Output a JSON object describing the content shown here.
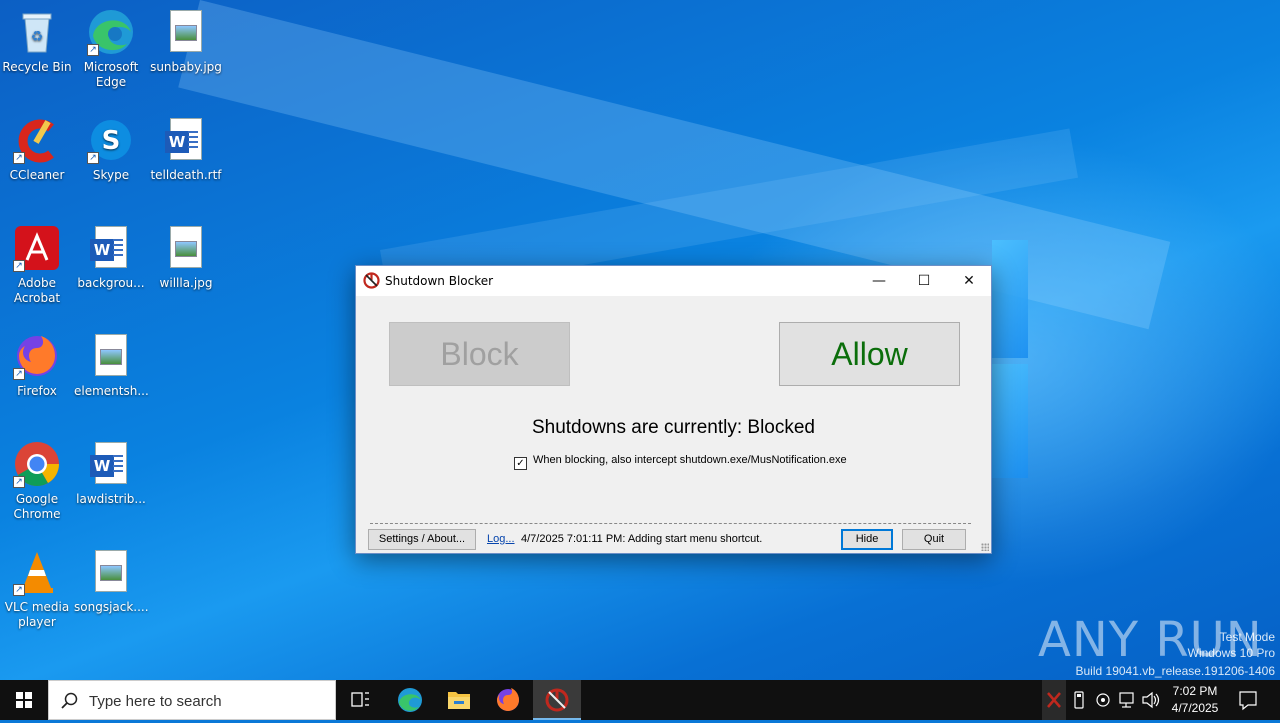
{
  "desktop": {
    "icons": [
      {
        "label": "Recycle Bin"
      },
      {
        "label": "Microsoft Edge"
      },
      {
        "label": "sunbaby.jpg"
      },
      {
        "label": "CCleaner"
      },
      {
        "label": "Skype"
      },
      {
        "label": "telldeath.rtf"
      },
      {
        "label": "Adobe Acrobat"
      },
      {
        "label": "backgrou..."
      },
      {
        "label": "willla.jpg"
      },
      {
        "label": "Firefox"
      },
      {
        "label": "elementsh..."
      },
      {
        "label": "Google Chrome"
      },
      {
        "label": "lawdistrib..."
      },
      {
        "label": "VLC media player"
      },
      {
        "label": "songsjack...."
      }
    ]
  },
  "window": {
    "title": "Shutdown Blocker",
    "block_label": "Block",
    "allow_label": "Allow",
    "status": "Shutdowns are currently: Blocked",
    "checkbox_label": "When blocking, also intercept shutdown.exe/MusNotification.exe",
    "checkbox_checked": true,
    "settings_label": "Settings / About...",
    "log_link": "Log...",
    "log_message": "4/7/2025 7:01:11 PM: Adding start menu shortcut.",
    "hide_label": "Hide",
    "quit_label": "Quit"
  },
  "watermark": {
    "brand": "ANY RUN",
    "line1": "Test Mode",
    "line2": "Windows 10 Pro",
    "line3": "Build 19041.vb_release.191206-1406"
  },
  "taskbar": {
    "search_placeholder": "Type here to search",
    "time": "7:02 PM",
    "date": "4/7/2025"
  },
  "colors": {
    "allow_green": "#0b6e0b",
    "taskbar": "#101010",
    "accent": "#0078d7"
  }
}
